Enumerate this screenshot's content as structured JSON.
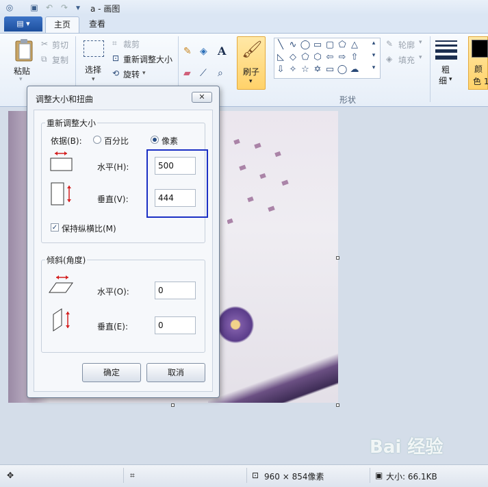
{
  "window": {
    "title": "a - 画图"
  },
  "tabs": {
    "file_label": "▤ ▾",
    "home": "主页",
    "view": "查看"
  },
  "ribbon": {
    "paste": "粘贴",
    "cut": "剪切",
    "copy": "复制",
    "select": "选择",
    "crop": "裁剪",
    "resize": "重新调整大小",
    "rotate": "旋转",
    "brush": "刷子",
    "outline": "轮廓",
    "fill": "填充",
    "size_top": "粗",
    "size_bottom": "细",
    "color_top": "颜",
    "color_bottom": "色 1",
    "shapes_group": "形状"
  },
  "dialog": {
    "title": "调整大小和扭曲",
    "close": "✕",
    "resize_section": "重新调整大小",
    "by_label": "依据(B):",
    "percent_label": "百分比",
    "pixels_label": "像素",
    "selected_unit": "像素",
    "horizontal_label": "水平(H):",
    "horizontal_value": "500",
    "vertical_label": "垂直(V):",
    "vertical_value": "444",
    "keep_ratio_label": "保持纵横比(M)",
    "keep_ratio_checked": true,
    "skew_section": "倾斜(角度)",
    "skew_h_label": "水平(O):",
    "skew_h_value": "0",
    "skew_v_label": "垂直(E):",
    "skew_v_value": "0",
    "ok": "确定",
    "cancel": "取消"
  },
  "status": {
    "image_size": "960 × 854像素",
    "file_size": "大小: 66.1KB"
  },
  "watermark": "Bai 经验",
  "colors": {
    "highlight_box": "#1a2fc4",
    "brush_active": "#ffd26a"
  }
}
